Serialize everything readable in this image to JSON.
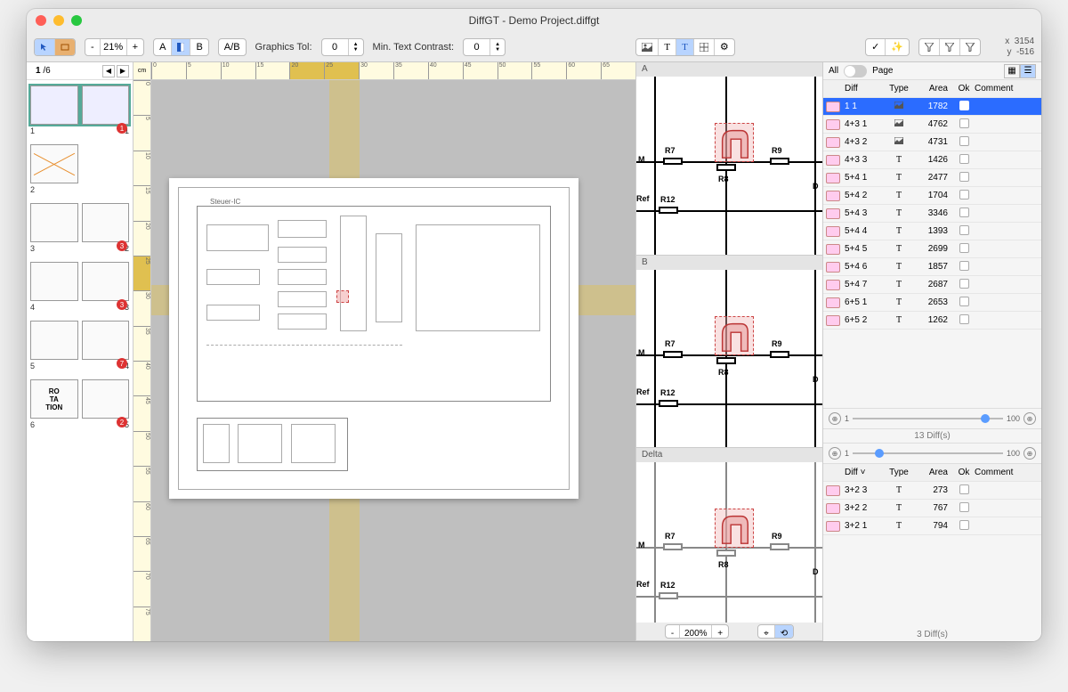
{
  "title": "DiffGT - Demo Project.diffgt",
  "toolbar": {
    "zoom_minus": "-",
    "zoom_pct": "21%",
    "zoom_plus": "+",
    "seg_a": "A",
    "seg_b": "B",
    "seg_ab": "A/B",
    "gtol_label": "Graphics Tol:",
    "gtol_val": "0",
    "mtc_label": "Min. Text Contrast:",
    "mtc_val": "0"
  },
  "coords": {
    "x_label": "x",
    "x_val": "3154",
    "y_label": "y",
    "y_val": "-516"
  },
  "thumbs": {
    "page_cur": "1",
    "page_sep": "/",
    "page_tot": "6",
    "pairs": [
      {
        "l": "1",
        "r": "1",
        "badge": "1",
        "sel": true
      },
      {
        "l": "2",
        "r": "",
        "x": true
      },
      {
        "l": "3",
        "r": "2",
        "badge": "3"
      },
      {
        "l": "4",
        "r": "3",
        "badge": "3"
      },
      {
        "l": "5",
        "r": "4",
        "badge": "7"
      },
      {
        "l": "6",
        "r": "5",
        "badge": "2",
        "rot": "RO\nTA\nTION"
      }
    ]
  },
  "ruler": {
    "unit": "cm",
    "h": [
      "0",
      "5",
      "10",
      "15",
      "20",
      "25",
      "30",
      "35",
      "40",
      "45",
      "50",
      "55",
      "60",
      "65"
    ],
    "v": [
      "0",
      "5",
      "10",
      "15",
      "20",
      "25",
      "30",
      "35",
      "40",
      "45",
      "50",
      "55",
      "60",
      "65",
      "70",
      "75"
    ]
  },
  "schematic": {
    "title": "Steuer-IC"
  },
  "previews": {
    "a": "A",
    "b": "B",
    "delta": "Delta",
    "labels": {
      "m": "M",
      "ref": "Ref",
      "r7": "R7",
      "r8": "R8",
      "r9": "R9",
      "r12": "R12",
      "d": "D"
    },
    "zoom_minus": "-",
    "zoom_pct": "200%",
    "zoom_plus": "+"
  },
  "inspect": {
    "all": "All",
    "page": "Page",
    "cols": {
      "diff": "Diff",
      "type": "Type",
      "area": "Area",
      "ok": "Ok",
      "comment": "Comment"
    },
    "rows1": [
      {
        "id": "1 1",
        "type": "img",
        "area": "1782",
        "sel": true
      },
      {
        "id": "4+3 1",
        "type": "img",
        "area": "4762"
      },
      {
        "id": "4+3 2",
        "type": "img",
        "area": "4731"
      },
      {
        "id": "4+3 3",
        "type": "T",
        "area": "1426"
      },
      {
        "id": "5+4 1",
        "type": "T",
        "area": "2477"
      },
      {
        "id": "5+4 2",
        "type": "T",
        "area": "1704"
      },
      {
        "id": "5+4 3",
        "type": "T",
        "area": "3346"
      },
      {
        "id": "5+4 4",
        "type": "T",
        "area": "1393"
      },
      {
        "id": "5+4 5",
        "type": "T",
        "area": "2699"
      },
      {
        "id": "5+4 6",
        "type": "T",
        "area": "1857"
      },
      {
        "id": "5+4 7",
        "type": "T",
        "area": "2687"
      },
      {
        "id": "6+5 1",
        "type": "T",
        "area": "2653"
      },
      {
        "id": "6+5 2",
        "type": "T",
        "area": "1262"
      }
    ],
    "summary1": "13 Diff(s)",
    "slider1_min": "1",
    "slider1_max": "100",
    "rows2": [
      {
        "id": "3+2 3",
        "type": "T",
        "area": "273"
      },
      {
        "id": "3+2 2",
        "type": "T",
        "area": "767"
      },
      {
        "id": "3+2 1",
        "type": "T",
        "area": "794"
      }
    ],
    "summary2": "3 Diff(s)"
  }
}
